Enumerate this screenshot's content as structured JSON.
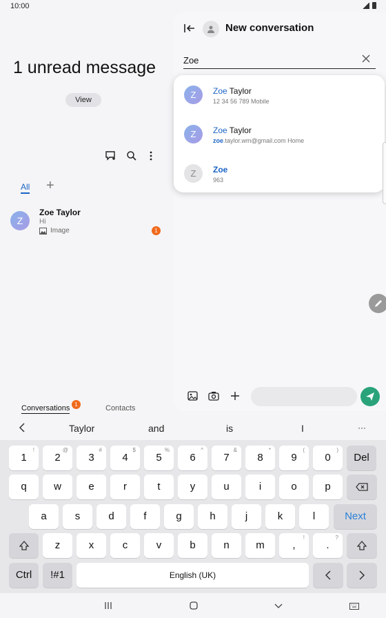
{
  "status": {
    "time": "10:00"
  },
  "left": {
    "unread_title": "1 unread message",
    "view_label": "View",
    "filter_all": "All",
    "filter_add": "+",
    "conversation": {
      "avatar_letter": "Z",
      "name": "Zoe Taylor",
      "message": "Hi",
      "attachment": "Image",
      "badge": "1"
    },
    "tabs": {
      "conversations": "Conversations",
      "conversations_badge": "1",
      "contacts": "Contacts"
    }
  },
  "right": {
    "title": "New conversation",
    "search_value": "Zoe",
    "suggestions": [
      {
        "avatar": "Z",
        "match": "Zoe",
        "rest": " Taylor",
        "detail": "12 34 56 789 Mobile"
      },
      {
        "avatar": "Z",
        "match": "Zoe",
        "rest": " Taylor",
        "detail_match": "zoe",
        "detail_rest": ".taylor.wm@gmail.com  Home"
      },
      {
        "avatar": "Z",
        "match": "Zoe",
        "rest": "",
        "detail": "963"
      }
    ]
  },
  "keyboard": {
    "suggestions": [
      "Taylor",
      "and",
      "is",
      "I",
      "···"
    ],
    "row1": [
      {
        "k": "1",
        "s": "!"
      },
      {
        "k": "2",
        "s": "@"
      },
      {
        "k": "3",
        "s": "#"
      },
      {
        "k": "4",
        "s": "$"
      },
      {
        "k": "5",
        "s": "%"
      },
      {
        "k": "6",
        "s": "^"
      },
      {
        "k": "7",
        "s": "&"
      },
      {
        "k": "8",
        "s": "*"
      },
      {
        "k": "9",
        "s": "("
      },
      {
        "k": "0",
        "s": ")"
      },
      {
        "k": "Del",
        "s": ""
      }
    ],
    "row2": [
      "q",
      "w",
      "e",
      "r",
      "t",
      "y",
      "u",
      "i",
      "o",
      "p"
    ],
    "row3": [
      "a",
      "s",
      "d",
      "f",
      "g",
      "h",
      "j",
      "k",
      "l"
    ],
    "next": "Next",
    "row4": [
      {
        "k": "z",
        "s": ""
      },
      {
        "k": "x",
        "s": ""
      },
      {
        "k": "c",
        "s": ""
      },
      {
        "k": "v",
        "s": ""
      },
      {
        "k": "b",
        "s": ""
      },
      {
        "k": "n",
        "s": ""
      },
      {
        "k": "m",
        "s": ""
      },
      {
        "k": ",",
        "s": "!"
      },
      {
        "k": ".",
        "s": "?"
      }
    ],
    "ctrl": "Ctrl",
    "sym": "!#1",
    "space": "English (UK)"
  },
  "colors": {
    "accent": "#1a63c6",
    "badge": "#f06a1c",
    "send": "#2aa37a"
  }
}
